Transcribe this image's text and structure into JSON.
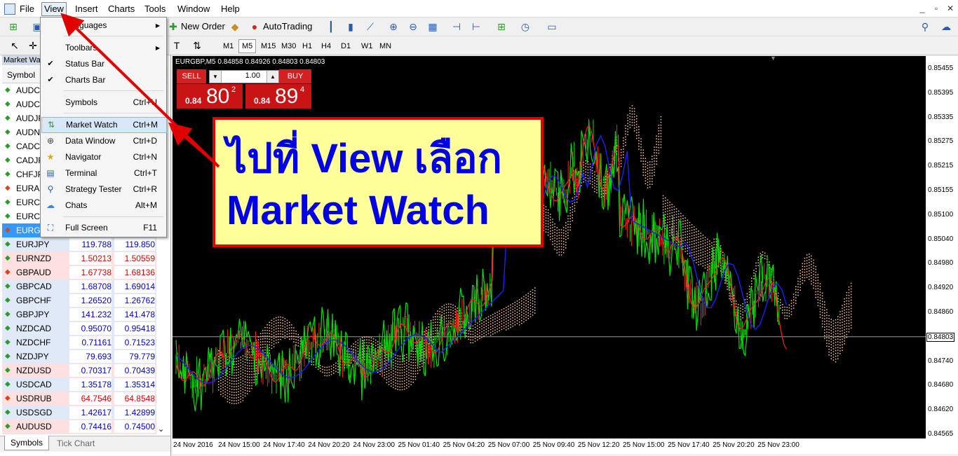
{
  "menu": {
    "items": [
      "File",
      "View",
      "Insert",
      "Charts",
      "Tools",
      "Window",
      "Help"
    ]
  },
  "toolbar": {
    "new_order": "New Order",
    "autotrading": "AutoTrading",
    "timeframes": [
      "M1",
      "M5",
      "M15",
      "M30",
      "H1",
      "H4",
      "D1",
      "W1",
      "MN"
    ],
    "active_timeframe": "M5"
  },
  "view_menu": {
    "items": [
      {
        "label": "Languages",
        "shortcut": "",
        "submenu": true,
        "icon": ""
      },
      {
        "label": "Toolbars",
        "shortcut": "",
        "submenu": true,
        "icon": ""
      },
      {
        "label": "Status Bar",
        "shortcut": "",
        "checked": true,
        "icon": "check-icon"
      },
      {
        "label": "Charts Bar",
        "shortcut": "",
        "checked": true,
        "icon": "check-icon"
      },
      {
        "label": "Symbols",
        "shortcut": "Ctrl+U",
        "icon": ""
      },
      {
        "label": "Market Watch",
        "shortcut": "Ctrl+M",
        "icon": "market-watch-icon",
        "highlighted": true
      },
      {
        "label": "Data Window",
        "shortcut": "Ctrl+D",
        "icon": "crosshair-icon"
      },
      {
        "label": "Navigator",
        "shortcut": "Ctrl+N",
        "icon": "star-folder-icon"
      },
      {
        "label": "Terminal",
        "shortcut": "Ctrl+T",
        "icon": "terminal-icon"
      },
      {
        "label": "Strategy Tester",
        "shortcut": "Ctrl+R",
        "icon": "tester-icon"
      },
      {
        "label": "Chats",
        "shortcut": "Alt+M",
        "icon": "chat-icon"
      },
      {
        "label": "Full Screen",
        "shortcut": "F11",
        "icon": "fullscreen-icon"
      }
    ]
  },
  "market_watch": {
    "title": "Market Wa",
    "column_symbol": "Symbol",
    "rows": [
      {
        "symbol": "AUDC",
        "bid": "",
        "ask": "",
        "dir": "up",
        "bg": "#fff8d8"
      },
      {
        "symbol": "AUDC",
        "bid": "",
        "ask": "",
        "dir": "up",
        "bg": "#fff8d8"
      },
      {
        "symbol": "AUDJP",
        "bid": "",
        "ask": "",
        "dir": "up",
        "bg": "#fff8d8"
      },
      {
        "symbol": "AUDN",
        "bid": "",
        "ask": "",
        "dir": "up",
        "bg": "#fff8d8"
      },
      {
        "symbol": "CADC",
        "bid": "",
        "ask": "",
        "dir": "up",
        "bg": "#fff8d8"
      },
      {
        "symbol": "CADJP",
        "bid": "",
        "ask": "",
        "dir": "up",
        "bg": "#fff8d8"
      },
      {
        "symbol": "CHFJP",
        "bid": "",
        "ask": "",
        "dir": "up",
        "bg": "#fff8d8"
      },
      {
        "symbol": "EURAU",
        "bid": "",
        "ask": "",
        "dir": "down",
        "bg": "#fff8d8"
      },
      {
        "symbol": "EURCA",
        "bid": "",
        "ask": "",
        "dir": "up",
        "bg": "#fff8d8"
      },
      {
        "symbol": "EURCH",
        "bid": "",
        "ask": "",
        "dir": "up",
        "bg": "#fff8d8"
      },
      {
        "symbol": "EURGE",
        "bid": "",
        "ask": "",
        "dir": "down",
        "bg": "#3399ff",
        "selected": true
      },
      {
        "symbol": "EURJPY",
        "bid": "119.788",
        "ask": "119.850",
        "dir": "up",
        "bg": "#dfe9f8",
        "color": "#0000c8"
      },
      {
        "symbol": "EURNZD",
        "bid": "1.50213",
        "ask": "1.50559",
        "dir": "up",
        "bg": "#fde0df",
        "color": "#d40000"
      },
      {
        "symbol": "GBPAUD",
        "bid": "1.67738",
        "ask": "1.68136",
        "dir": "down",
        "bg": "#fde0df",
        "color": "#d40000"
      },
      {
        "symbol": "GBPCAD",
        "bid": "1.68708",
        "ask": "1.69014",
        "dir": "up",
        "bg": "#dfe9f8",
        "color": "#0000c8"
      },
      {
        "symbol": "GBPCHF",
        "bid": "1.26520",
        "ask": "1.26762",
        "dir": "up",
        "bg": "#dfe9f8",
        "color": "#0000c8"
      },
      {
        "symbol": "GBPJPY",
        "bid": "141.232",
        "ask": "141.478",
        "dir": "up",
        "bg": "#dfe9f8",
        "color": "#0000c8"
      },
      {
        "symbol": "NZDCAD",
        "bid": "0.95070",
        "ask": "0.95418",
        "dir": "up",
        "bg": "#dfe9f8",
        "color": "#0000c8"
      },
      {
        "symbol": "NZDCHF",
        "bid": "0.71161",
        "ask": "0.71523",
        "dir": "up",
        "bg": "#dfe9f8",
        "color": "#0000c8"
      },
      {
        "symbol": "NZDJPY",
        "bid": "79.693",
        "ask": "79.779",
        "dir": "up",
        "bg": "#dfe9f8",
        "color": "#0000c8"
      },
      {
        "symbol": "NZDUSD",
        "bid": "0.70317",
        "ask": "0.70439",
        "dir": "up",
        "bg": "#fde0df",
        "color": "#0000c8"
      },
      {
        "symbol": "USDCAD",
        "bid": "1.35178",
        "ask": "1.35314",
        "dir": "up",
        "bg": "#dfe9f8",
        "color": "#0000c8"
      },
      {
        "symbol": "USDRUB",
        "bid": "64.7546",
        "ask": "64.8548",
        "dir": "down",
        "bg": "#fde0df",
        "color": "#d40000"
      },
      {
        "symbol": "USDSGD",
        "bid": "1.42617",
        "ask": "1.42899",
        "dir": "up",
        "bg": "#dfe9f8",
        "color": "#0000c8"
      },
      {
        "symbol": "AUDUSD",
        "bid": "0.74416",
        "ask": "0.74500",
        "dir": "up",
        "bg": "#fde0df",
        "color": "#0000c8"
      }
    ],
    "tabs": [
      "Symbols",
      "Tick Chart"
    ]
  },
  "chart": {
    "header": "EURGBP,M5  0.84858 0.84926 0.84803 0.84803",
    "sell_label": "SELL",
    "buy_label": "BUY",
    "lot": "1.00",
    "sell_prefix": "0.84",
    "sell_big": "80",
    "sell_sup": "2",
    "buy_prefix": "0.84",
    "buy_big": "89",
    "buy_sup": "4",
    "current_price": "0.84803",
    "price_ticks": [
      "0.85455",
      "0.85395",
      "0.85335",
      "0.85275",
      "0.85215",
      "0.85155",
      "0.85100",
      "0.85040",
      "0.84980",
      "0.84920",
      "0.84860",
      "0.84803",
      "0.84740",
      "0.84680",
      "0.84620",
      "0.84565"
    ],
    "time_ticks": [
      "24 Nov 2016",
      "24 Nov 15:00",
      "24 Nov 17:40",
      "24 Nov 20:20",
      "24 Nov 23:00",
      "25 Nov 01:40",
      "25 Nov 04:20",
      "25 Nov 07:00",
      "25 Nov 09:40",
      "25 Nov 12:20",
      "25 Nov 15:00",
      "25 Nov 17:40",
      "25 Nov 20:20",
      "25 Nov 23:00"
    ],
    "colors": {
      "green": "#00e000",
      "red": "#ff2020",
      "blue": "#1e1eff",
      "cloud": "#ffc9a0"
    }
  },
  "annotation": {
    "line1": "ไปที่ View เลือก",
    "line2": "Market Watch",
    "text_color": "#0000e6",
    "bg": "#ffff99",
    "border": "#e00000"
  }
}
